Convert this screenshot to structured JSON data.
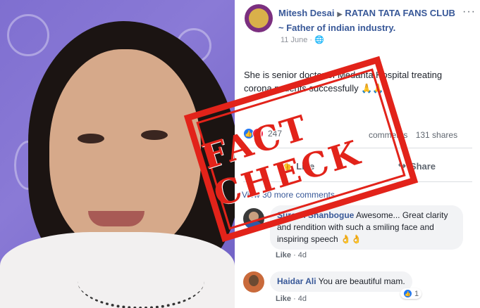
{
  "post": {
    "author": "Mitesh Desai",
    "group": "RATAN TATA FANS CLUB ~ Father of indian industry.",
    "date": "11 June",
    "more_icon": "···",
    "text": "She is senior doctor of Medanta Hospital treating corona patients successfully 🙏🙏",
    "reaction_count": "247",
    "comments_count": "comments",
    "shares_count": "131 shares",
    "like_label": "Like",
    "share_label": "Share",
    "view_more": "View 30 more comments"
  },
  "comments": [
    {
      "name": "Suresh Shanbogue",
      "text": "Awesome... Great clarity and rendition with such a smiling face and inspiring speech 👌👌",
      "like": "Like",
      "time": "4d"
    },
    {
      "name": "Haidar Ali",
      "text": "You are beautiful mam.",
      "like": "Like",
      "time": "4d",
      "reactions": "1"
    }
  ],
  "stamp": {
    "text": "FACT CHECK"
  },
  "colors": {
    "link": "#385898",
    "stamp": "#e2231a"
  }
}
